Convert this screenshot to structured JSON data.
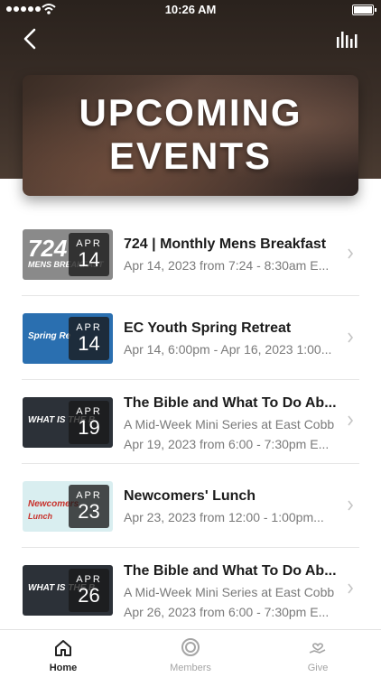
{
  "status_bar": {
    "time": "10:26 AM"
  },
  "hero": {
    "line1": "UPCOMING",
    "line2": "EVENTS"
  },
  "events": [
    {
      "thumb_text": "724",
      "thumb_sub": "MENS BREAKFAST",
      "thumb_bg": "#8a8a8a",
      "month": "APR",
      "day": "14",
      "title": "724 | Monthly Mens Breakfast",
      "subtitle": "Apr 14, 2023 from 7:24 - 8:30am E...",
      "detail": ""
    },
    {
      "thumb_text": "Spring Re",
      "thumb_sub": "",
      "thumb_bg": "#2a6fb0",
      "month": "APR",
      "day": "14",
      "title": "EC Youth Spring Retreat",
      "subtitle": "Apr 14, 6:00pm - Apr 16, 2023 1:00...",
      "detail": ""
    },
    {
      "thumb_text": "WHAT IS THE B",
      "thumb_sub": "",
      "thumb_bg": "#2c3138",
      "month": "APR",
      "day": "19",
      "title": "The Bible and What To Do Ab...",
      "subtitle": "A Mid-Week Mini Series at East Cobb",
      "detail": "Apr 19, 2023 from 6:00 - 7:30pm E..."
    },
    {
      "thumb_text": "Newcomers",
      "thumb_sub": "Lunch",
      "thumb_bg": "#d9eef0",
      "month": "APR",
      "day": "23",
      "title": "Newcomers' Lunch",
      "subtitle": "Apr 23, 2023 from 12:00 - 1:00pm...",
      "detail": ""
    },
    {
      "thumb_text": "WHAT IS THE B",
      "thumb_sub": "",
      "thumb_bg": "#2c3138",
      "month": "APR",
      "day": "26",
      "title": "The Bible and What To Do Ab...",
      "subtitle": "A Mid-Week Mini Series at East Cobb",
      "detail": "Apr 26, 2023 from 6:00 - 7:30pm E..."
    }
  ],
  "tabs": [
    {
      "label": "Home",
      "icon": "home-icon",
      "active": true
    },
    {
      "label": "Members",
      "icon": "members-icon",
      "active": false
    },
    {
      "label": "Give",
      "icon": "give-icon",
      "active": false
    }
  ]
}
